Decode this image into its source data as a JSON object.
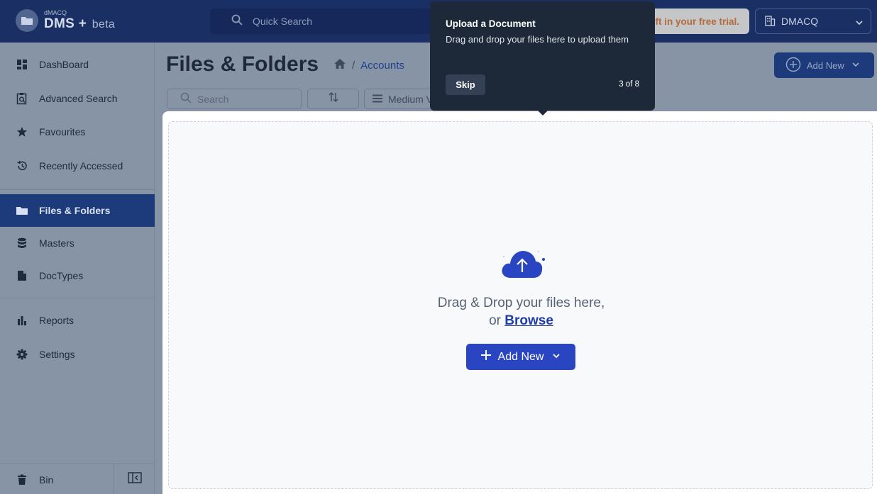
{
  "header": {
    "logo_small": "dMACQ",
    "logo_main": "DMS",
    "logo_plus": "+",
    "logo_beta": "beta",
    "quick_search_placeholder": "Quick Search",
    "trial_text": "ft in your free trial.",
    "org_name": "DMACQ"
  },
  "sidebar": {
    "items": [
      {
        "label": "DashBoard",
        "icon": "dashboard-icon"
      },
      {
        "label": "Advanced Search",
        "icon": "advanced-search-icon"
      },
      {
        "label": "Favourites",
        "icon": "star-icon"
      },
      {
        "label": "Recently Accessed",
        "icon": "history-icon"
      },
      {
        "label": "Files & Folders",
        "icon": "folder-icon",
        "active": true
      },
      {
        "label": "Masters",
        "icon": "database-icon"
      },
      {
        "label": "DocTypes",
        "icon": "document-icon"
      },
      {
        "label": "Reports",
        "icon": "bar-chart-icon"
      },
      {
        "label": "Settings",
        "icon": "gear-icon"
      }
    ],
    "bin_label": "Bin"
  },
  "main": {
    "title": "Files & Folders",
    "breadcrumb": {
      "separator": "/",
      "current": "Accounts"
    },
    "add_new_label": "Add New",
    "search_placeholder": "Search",
    "view_label": "Medium V",
    "drop_line1": "Drag & Drop your files here,",
    "drop_or": "or",
    "browse_label": "Browse",
    "add_new_main_label": "Add New"
  },
  "tour": {
    "title": "Upload a Document",
    "body": "Drag and drop your files here to upload them",
    "skip_label": "Skip",
    "step_text": "3 of 8"
  },
  "colors": {
    "header_bg": "#1a2f63",
    "sidebar_active": "#1d3a7b",
    "primary_button": "#2a45c2",
    "tooltip_bg": "#1d2939",
    "overlay": "#8794a6"
  }
}
